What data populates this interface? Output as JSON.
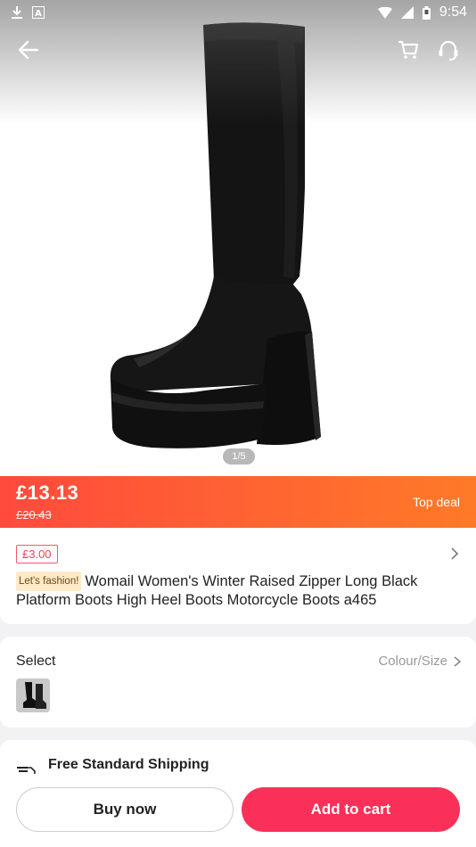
{
  "status_bar": {
    "time": "9:54",
    "left_icons": [
      "download-icon",
      "a-icon"
    ],
    "right_icons": [
      "wifi-icon",
      "signal-icon",
      "battery-icon"
    ]
  },
  "header": {
    "icons": [
      "back-arrow-icon",
      "cart-icon",
      "headset-icon"
    ]
  },
  "gallery": {
    "indicator": "1/5"
  },
  "price": {
    "current": "£13.13",
    "original": "£20.43",
    "deal_label": "Top deal",
    "gradient": [
      "#ff4a3d",
      "#ff7a28"
    ]
  },
  "product": {
    "coupon": "£3.00",
    "tag": "Let's fashion!",
    "title": "Womail Women's Winter Raised Zipper Long Black Platform Boots High Heel Boots  Motorcycle Boots a465"
  },
  "select": {
    "label": "Select",
    "option_label": "Colour/Size"
  },
  "shipping": {
    "title": "Free Standard Shipping"
  },
  "actions": {
    "buy_now": "Buy now",
    "add_to_cart": "Add to cart",
    "accent_color": "#fb3058"
  }
}
